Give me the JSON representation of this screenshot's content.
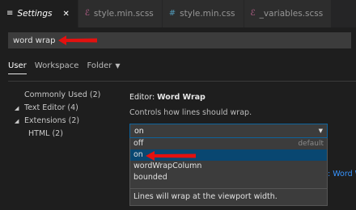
{
  "tabs": [
    {
      "label": "Settings",
      "icon": "gear-icon",
      "icon_glyph": "≡",
      "icon_color": "#cccccc",
      "active": true,
      "close": "✕"
    },
    {
      "label": "style.min.scss",
      "icon": "scss-file-icon",
      "icon_glyph": "ℰ",
      "icon_color": "#cd6799"
    },
    {
      "label": "style.min.css",
      "icon": "css-file-icon",
      "icon_glyph": "#",
      "icon_color": "#519aba"
    },
    {
      "label": "_variables.scss",
      "icon": "scss-file-icon",
      "icon_glyph": "ℰ",
      "icon_color": "#cd6799"
    }
  ],
  "search": {
    "value": "word wrap"
  },
  "scope_tabs": {
    "user": "User",
    "workspace": "Workspace",
    "folder": "Folder",
    "folder_caret": "▼"
  },
  "tree": {
    "commonly_used": "Commonly Used (2)",
    "text_editor": "Text Editor (4)",
    "extensions": "Extensions (2)",
    "html": "HTML (2)",
    "caret": "◢"
  },
  "setting": {
    "category": "Editor: ",
    "name": "Word Wrap",
    "description": "Controls how lines should wrap."
  },
  "select": {
    "value": "on",
    "caret": "▼",
    "options": [
      {
        "label": "off",
        "hint": "default"
      },
      {
        "label": "on",
        "hint": ""
      },
      {
        "label": "wordWrapColumn",
        "hint": ""
      },
      {
        "label": "bounded",
        "hint": ""
      }
    ],
    "highlighted_index": 1,
    "option_description": "Lines will wrap at the viewport width."
  },
  "peek_text": ": Word W",
  "colors": {
    "accent": "#0e639c",
    "arrow": "#e3110f",
    "highlight": "#094771"
  }
}
